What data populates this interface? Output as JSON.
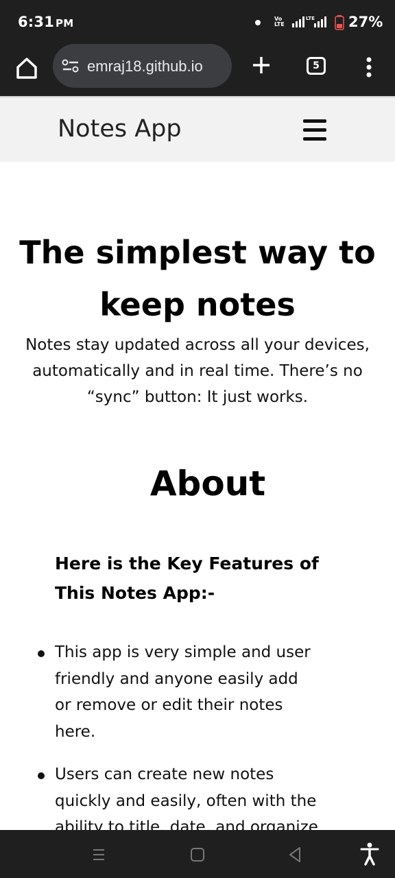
{
  "status_bar": {
    "time": "6:31",
    "ampm": "PM",
    "network_label": "Vo LTE",
    "battery_percent": "27%"
  },
  "browser": {
    "url": "emraj18.github.io",
    "tab_count": "5",
    "icons": [
      "home-icon",
      "site-settings-icon",
      "new-tab-icon",
      "tab-switcher-icon",
      "more-menu-icon"
    ]
  },
  "navbar": {
    "brand": "Notes App",
    "menu_icon": "hamburger-menu-icon"
  },
  "hero": {
    "title_line1": "The simplest way to",
    "title_line2": "keep notes",
    "subtitle_line1": "Notes stay updated across all your devices,",
    "subtitle_line2": "automatically and in real time. There’s no",
    "subtitle_line3": "“sync” button: It just works."
  },
  "about": {
    "title": "About",
    "features_heading_line1": "Here is the Key Features of",
    "features_heading_line2": "This Notes App:-",
    "features": [
      {
        "line1": "This app is very simple and user",
        "line2": "friendly and anyone easily add",
        "line3": "or remove or edit their notes",
        "line4": "here."
      },
      {
        "line1": "Users can create new notes",
        "line2": "quickly and easily, often with the",
        "line3": "ability to title, date, and organize"
      }
    ]
  },
  "system_nav": {
    "icons": [
      "recents-icon",
      "home-nav-icon",
      "back-icon",
      "accessibility-icon"
    ]
  },
  "colors": {
    "system_bar_bg": "#1f1f1f",
    "url_pill_bg": "#3c3d40",
    "navbar_bg": "#f2f2f2",
    "text": "#000000"
  }
}
